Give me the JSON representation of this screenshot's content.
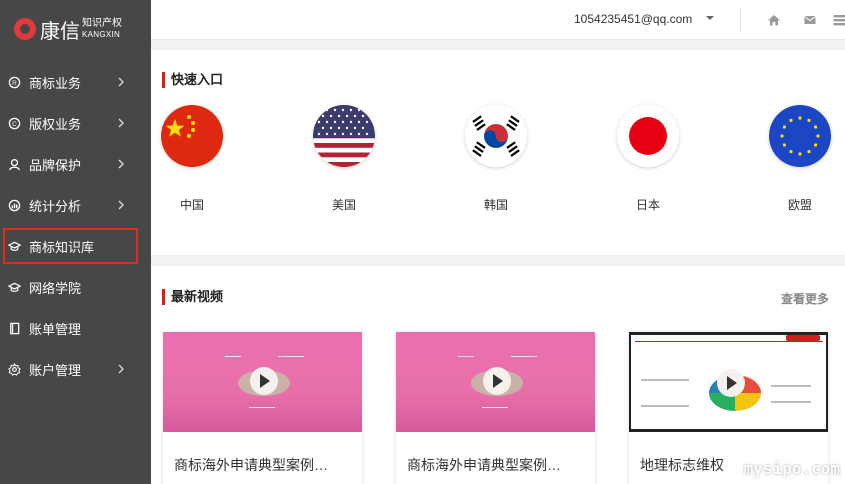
{
  "brand": {
    "name": "康信",
    "sub_cn": "知识产权",
    "sub_en": "KANGXIN"
  },
  "sidebar": {
    "items": [
      {
        "label": "商标业务",
        "icon": "trademark-icon",
        "expandable": true
      },
      {
        "label": "版权业务",
        "icon": "copyright-icon",
        "expandable": true
      },
      {
        "label": "品牌保护",
        "icon": "user-icon",
        "expandable": true
      },
      {
        "label": "统计分析",
        "icon": "chart-icon",
        "expandable": true
      },
      {
        "label": "商标知识库",
        "icon": "graduation-cap-icon",
        "expandable": false,
        "active": true
      },
      {
        "label": "网络学院",
        "icon": "graduation-cap-icon",
        "expandable": false
      },
      {
        "label": "账单管理",
        "icon": "book-icon",
        "expandable": false
      },
      {
        "label": "账户管理",
        "icon": "gear-icon",
        "expandable": true
      }
    ]
  },
  "topbar": {
    "email": "1054235451@qq.com",
    "icons": [
      "home-icon",
      "mail-icon",
      "grid-icon"
    ]
  },
  "quick": {
    "title": "快速入口",
    "flags": [
      {
        "label": "中国",
        "icon": "china-flag-icon"
      },
      {
        "label": "美国",
        "icon": "usa-flag-icon"
      },
      {
        "label": "韩国",
        "icon": "korea-flag-icon"
      },
      {
        "label": "日本",
        "icon": "japan-flag-icon"
      },
      {
        "label": "欧盟",
        "icon": "eu-flag-icon"
      }
    ]
  },
  "videos": {
    "title": "最新视频",
    "more": "查看更多",
    "cards": [
      {
        "title": "商标海外申请典型案例…"
      },
      {
        "title": "商标海外申请典型案例…"
      },
      {
        "title": "地理标志维权"
      }
    ]
  },
  "watermark": "mysipo.com",
  "colors": {
    "sidebar": "#474747",
    "accent": "#c9221f",
    "active_outline": "#e8291d"
  }
}
